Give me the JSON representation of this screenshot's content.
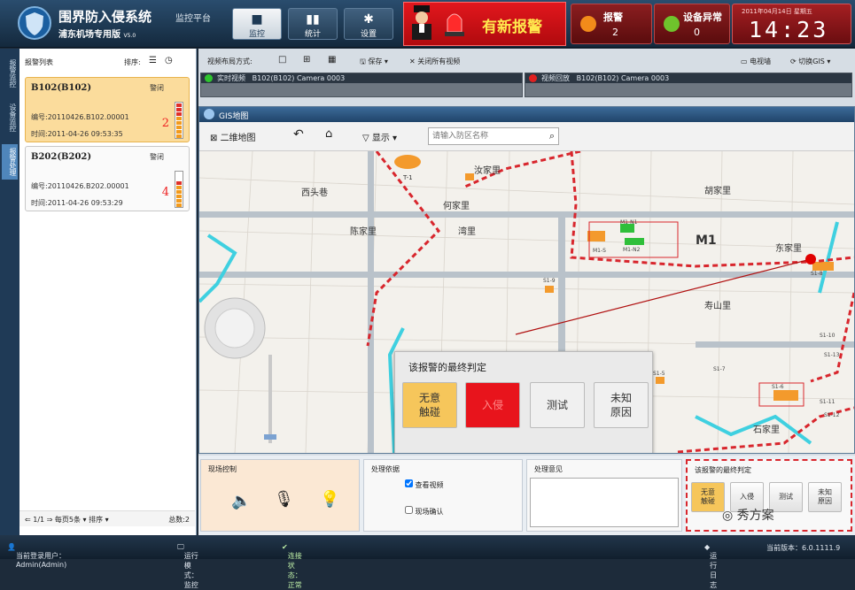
{
  "header": {
    "title": "围界防入侵系统",
    "subtitle": "监控平台",
    "edition": "浦东机场专用版",
    "version": "V5.0",
    "nav": [
      {
        "label": "监控",
        "icon": "camera-icon",
        "active": true
      },
      {
        "label": "统计",
        "icon": "bar-chart-icon",
        "active": false
      },
      {
        "label": "设置",
        "icon": "gear-icon",
        "active": false
      }
    ],
    "alarm_banner": "有新报警",
    "alarm_count_label": "报警",
    "alarm_count": "2",
    "device_error_label": "设备异常",
    "device_error_count": "0",
    "date": "2011年04月14日 星期五",
    "time": "14:23"
  },
  "left_tabs": [
    "报警监控",
    "设备监控",
    "报警处理"
  ],
  "alarm_list": {
    "title": "报警列表",
    "sort_label": "排序:",
    "items": [
      {
        "name": "B102(B102)",
        "status": "警闭",
        "id_label": "编号:",
        "id": "20110426.B102.00001",
        "time_label": "时间:",
        "time": "2011-04-26 09:53:35",
        "count": "2",
        "level": 1.0,
        "selected": true
      },
      {
        "name": "B202(B202)",
        "status": "警闭",
        "id_label": "编号:",
        "id": "20110426.B202.00001",
        "time_label": "时间:",
        "time": "2011-04-26 09:53:29",
        "count": "4",
        "level": 0.7,
        "selected": false
      }
    ],
    "footer": {
      "page": "1/1",
      "per_page": "每页5条",
      "sort": "排序",
      "total": "总数:2"
    }
  },
  "video_toolbar": {
    "layout_label": "视频布局方式:",
    "save": "保存",
    "close_all": "关闭所有视频",
    "tv_wall": "电视墙",
    "switch_gis": "切换GIS"
  },
  "cameras": [
    {
      "mode": "实时视频",
      "name": "B102(B102) Camera 0003",
      "dot_color": "#2ec52e"
    },
    {
      "mode": "视频回放",
      "name": "B102(B102) Camera 0003",
      "dot_color": "#e02020"
    }
  ],
  "gis": {
    "title": "GIS地图",
    "map_2d": "二维地图",
    "display": "显示",
    "search_placeholder": "请输入防区名称",
    "places": [
      "汝家里",
      "西头巷",
      "何家里",
      "陈家里",
      "湾里",
      "胡家里",
      "东家里",
      "寿山里",
      "石家里",
      "M1",
      "T-1"
    ],
    "zones": [
      "M1-N1",
      "M1-N2",
      "M1-S",
      "S1-5",
      "S1-6",
      "S1-7",
      "S1-8",
      "S1-9",
      "S1-10",
      "S1-11",
      "S1-12",
      "S1-13"
    ]
  },
  "judgment": {
    "title": "该报警的最终判定",
    "buttons": [
      {
        "label": "无意\n触碰",
        "color": "#f6c65b"
      },
      {
        "label": "入侵",
        "color": "#e8141c"
      },
      {
        "label": "测试",
        "color": "#f0f0f0"
      },
      {
        "label": "未知\n原因",
        "color": "#f0f0f0"
      }
    ]
  },
  "bottom": {
    "field_control": "现场控制",
    "evidence": "处理依据",
    "evidence_options": [
      {
        "label": "查看视频",
        "checked": true
      },
      {
        "label": "现场确认",
        "checked": false
      }
    ],
    "opinion": "处理意见",
    "final_judgment": "该报警的最终判定",
    "mini_buttons": [
      "无意\n触碰",
      "入侵",
      "测试",
      "未知\n原因"
    ]
  },
  "statusbar": {
    "user": "当前登录用户：Admin(Admin)",
    "mode": "运行模式：监控",
    "conn": "连接状态：正常",
    "log": "运行日志",
    "version": "当前版本：6.0.1111.9"
  },
  "watermark": "秀方案"
}
